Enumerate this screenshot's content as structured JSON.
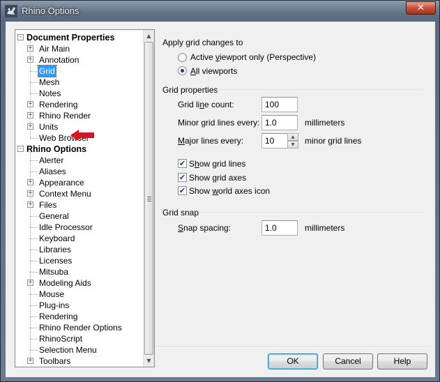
{
  "window": {
    "title": "Rhino Options",
    "close_glyph": "✕"
  },
  "tree": {
    "rows": [
      {
        "label": "Document Properties",
        "level": 0,
        "bold": true,
        "expander": "-"
      },
      {
        "label": "Air Main",
        "level": 1,
        "expander": "+"
      },
      {
        "label": "Annotation",
        "level": 1,
        "expander": "+"
      },
      {
        "label": "Grid",
        "level": 1,
        "selected": true
      },
      {
        "label": "Mesh",
        "level": 1
      },
      {
        "label": "Notes",
        "level": 1
      },
      {
        "label": "Rendering",
        "level": 1,
        "expander": "+"
      },
      {
        "label": "Rhino Render",
        "level": 1,
        "expander": "+"
      },
      {
        "label": "Units",
        "level": 1,
        "expander": "+"
      },
      {
        "label": "Web Browser",
        "level": 1
      },
      {
        "label": "Rhino Options",
        "level": 0,
        "bold": true,
        "expander": "-"
      },
      {
        "label": "Alerter",
        "level": 1
      },
      {
        "label": "Aliases",
        "level": 1
      },
      {
        "label": "Appearance",
        "level": 1,
        "expander": "+"
      },
      {
        "label": "Context Menu",
        "level": 1,
        "expander": "+"
      },
      {
        "label": "Files",
        "level": 1,
        "expander": "+"
      },
      {
        "label": "General",
        "level": 1
      },
      {
        "label": "Idle Processor",
        "level": 1
      },
      {
        "label": "Keyboard",
        "level": 1
      },
      {
        "label": "Libraries",
        "level": 1
      },
      {
        "label": "Licenses",
        "level": 1
      },
      {
        "label": "Mitsuba",
        "level": 1
      },
      {
        "label": "Modeling Aids",
        "level": 1,
        "expander": "+"
      },
      {
        "label": "Mouse",
        "level": 1
      },
      {
        "label": "Plug-ins",
        "level": 1
      },
      {
        "label": "Rendering",
        "level": 1
      },
      {
        "label": "Rhino Render Options",
        "level": 1
      },
      {
        "label": "RhinoScript",
        "level": 1
      },
      {
        "label": "Selection Menu",
        "level": 1
      },
      {
        "label": "Toolbars",
        "level": 1,
        "expander": "+"
      }
    ],
    "annotation_arrow_color": "#e01020",
    "scroll_up": "▲",
    "scroll_down": "▼"
  },
  "apply": {
    "heading": "Apply grid changes to",
    "option_active": {
      "pre": "Active ",
      "ul": "v",
      "post": "iewport only (Perspective)"
    },
    "option_all": {
      "pre": "",
      "ul": "A",
      "post": "ll viewports"
    },
    "selected": "all"
  },
  "grid_properties": {
    "heading": "Grid properties",
    "line_count": {
      "pre": "Grid li",
      "ul": "n",
      "post": "e count:",
      "value": "100"
    },
    "minor_every": {
      "pre": "Minor ",
      "ul": "g",
      "post": "rid lines every:",
      "value": "1.0",
      "unit": "millimeters"
    },
    "major_every": {
      "pre": "",
      "ul": "M",
      "post": "ajor lines every:",
      "value": "10",
      "unit": "minor grid lines"
    },
    "show_grid_lines": {
      "pre": "S",
      "ul": "h",
      "post": "ow grid lines",
      "checked": true
    },
    "show_grid_axes": {
      "pre": "Show ",
      "ul": "g",
      "post": "rid axes",
      "checked": true
    },
    "show_world_axes": {
      "pre": "Show ",
      "ul": "w",
      "post": "orld axes icon",
      "checked": true
    }
  },
  "grid_snap": {
    "heading": "Grid snap",
    "snap_spacing": {
      "pre": "",
      "ul": "S",
      "post": "nap spacing:",
      "value": "1.0",
      "unit": "millimeters"
    }
  },
  "buttons": {
    "ok": "OK",
    "cancel": "Cancel",
    "help": "Help"
  },
  "glyphs": {
    "check": "✔",
    "spin_up": "▲",
    "spin_down": "▼"
  }
}
